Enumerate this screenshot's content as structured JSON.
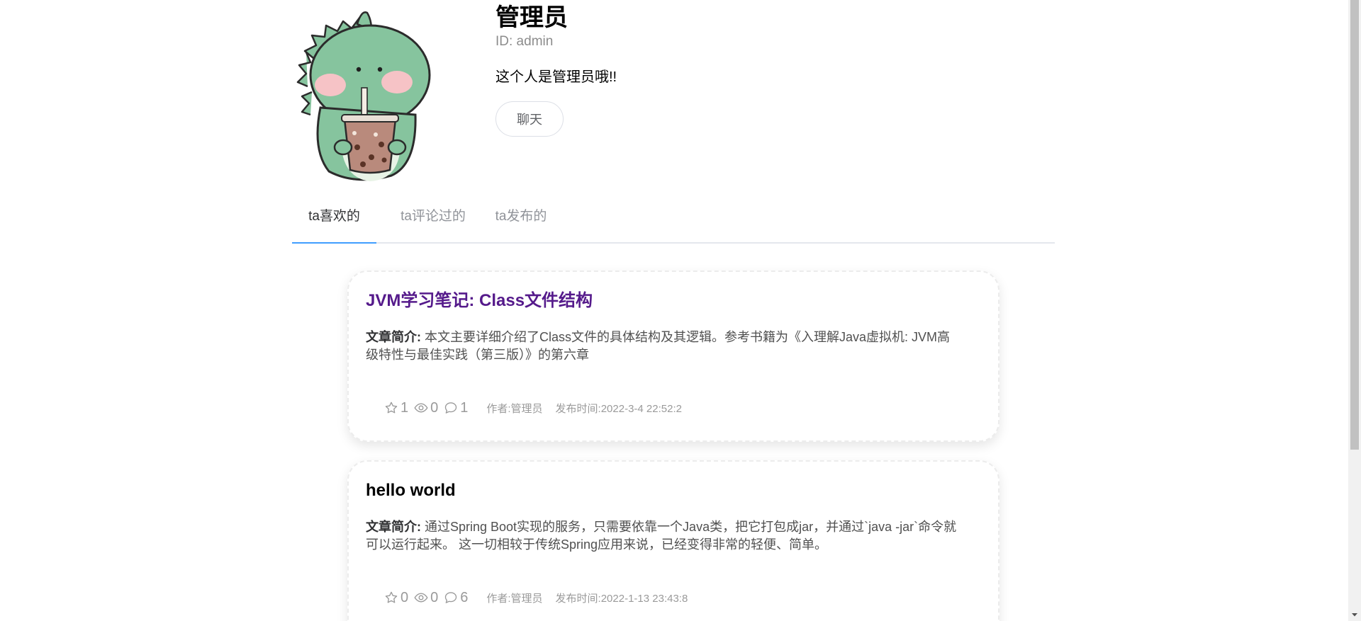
{
  "profile": {
    "name": "管理员",
    "id_text": "ID: admin",
    "bio": "这个人是管理员哦!!",
    "chat_label": "聊天"
  },
  "tabs": [
    {
      "label": "ta喜欢的",
      "active": true
    },
    {
      "label": "ta评论过的",
      "active": false
    },
    {
      "label": "ta发布的",
      "active": false
    }
  ],
  "articles": [
    {
      "title": "JVM学习笔记: Class文件结构",
      "summary_label": "文章简介:",
      "summary": " 本文主要详细介绍了Class文件的具体结构及其逻辑。参考书籍为《入理解Java虚拟机: JVM高级特性与最佳实践（第三版）》的第六章",
      "likes": "1",
      "views": "0",
      "comments": "1",
      "author": "作者:管理员",
      "published": "发布时间:2022-3-4 22:52:2"
    },
    {
      "title": "hello world",
      "summary_label": "文章简介:",
      "summary": " 通过Spring Boot实现的服务，只需要依靠一个Java类，把它打包成jar，并通过`java -jar`命令就可以运行起来。 这一切相较于传统Spring应用来说，已经变得非常的轻便、简单。",
      "likes": "0",
      "views": "0",
      "comments": "6",
      "author": "作者:管理员",
      "published": "发布时间:2022-1-13 23:43:8"
    }
  ],
  "icons": {
    "like": "star-icon",
    "views": "eye-icon",
    "comments": "comment-icon"
  },
  "colors": {
    "tab_active_ink": "#409eff",
    "visited_title": "#551a8b",
    "meta_gray": "#9a9a9a"
  }
}
